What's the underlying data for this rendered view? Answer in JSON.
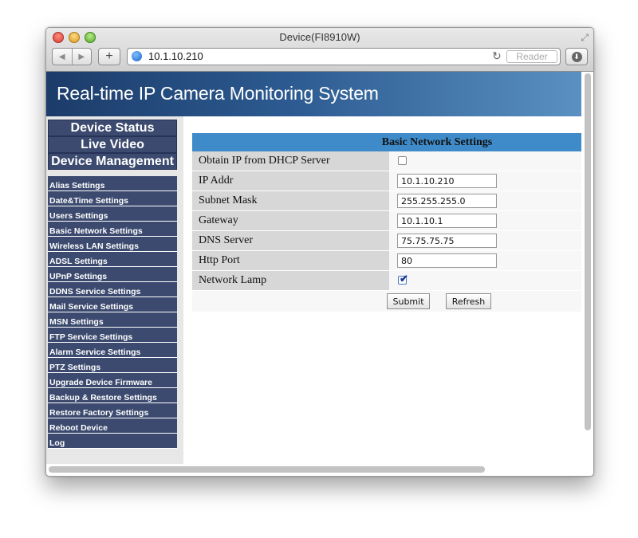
{
  "window": {
    "title": "Device(FI8910W)",
    "url": "10.1.10.210",
    "reader_label": "Reader"
  },
  "page": {
    "banner_title": "Real-time IP Camera Monitoring System"
  },
  "sidebar": {
    "headings": [
      "Device Status",
      "Live Video",
      "Device Management"
    ],
    "items": [
      "Alias Settings",
      "Date&Time Settings",
      "Users Settings",
      "Basic Network Settings",
      "Wireless LAN Settings",
      "ADSL Settings",
      "UPnP Settings",
      "DDNS Service Settings",
      "Mail Service Settings",
      "MSN Settings",
      "FTP Service Settings",
      "Alarm Service Settings",
      "PTZ Settings",
      "Upgrade Device Firmware",
      "Backup & Restore Settings",
      "Restore Factory Settings",
      "Reboot Device",
      "Log"
    ]
  },
  "form": {
    "title": "Basic Network Settings",
    "dhcp_label": "Obtain IP from DHCP Server",
    "dhcp_checked": false,
    "ip_label": "IP Addr",
    "ip_value": "10.1.10.210",
    "subnet_label": "Subnet Mask",
    "subnet_value": "255.255.255.0",
    "gateway_label": "Gateway",
    "gateway_value": "10.1.10.1",
    "dns_label": "DNS Server",
    "dns_value": "75.75.75.75",
    "port_label": "Http Port",
    "port_value": "80",
    "lamp_label": "Network Lamp",
    "lamp_checked": true,
    "submit_label": "Submit",
    "refresh_label": "Refresh"
  },
  "icons": {
    "close": "red-traffic-light",
    "minimize": "yellow-traffic-light",
    "zoom": "green-traffic-light",
    "site": "globe-icon",
    "reload": "reload-icon",
    "download": "download-icon"
  }
}
